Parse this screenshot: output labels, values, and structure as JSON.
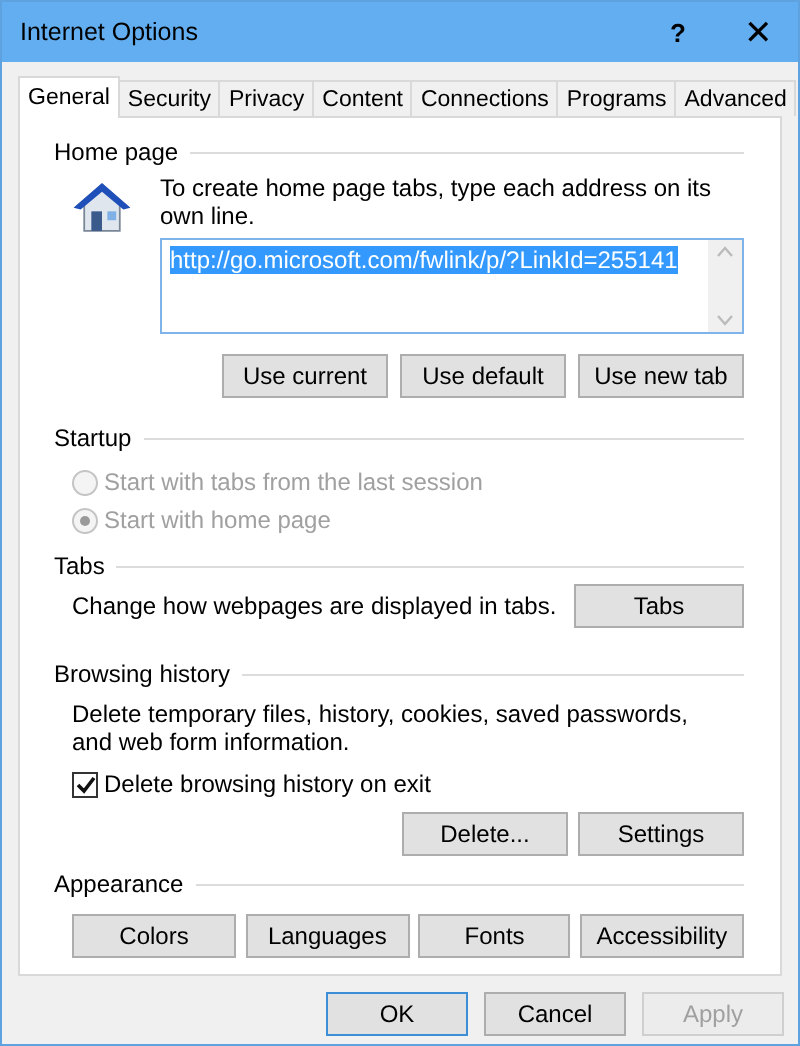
{
  "window": {
    "title": "Internet Options",
    "help": "?",
    "close": "✕"
  },
  "tabs": [
    {
      "label": "General",
      "selected": true
    },
    {
      "label": "Security",
      "selected": false
    },
    {
      "label": "Privacy",
      "selected": false
    },
    {
      "label": "Content",
      "selected": false
    },
    {
      "label": "Connections",
      "selected": false
    },
    {
      "label": "Programs",
      "selected": false
    },
    {
      "label": "Advanced",
      "selected": false
    }
  ],
  "home_page": {
    "heading": "Home page",
    "instruction": "To create home page tabs, type each address on its own line.",
    "value": "http://go.microsoft.com/fwlink/p/?LinkId=255141",
    "highlighted": true,
    "buttons": [
      "Use current",
      "Use default",
      "Use new tab"
    ]
  },
  "startup": {
    "heading": "Startup",
    "options": [
      {
        "label": "Start with tabs from the last session",
        "selected": false,
        "disabled": true
      },
      {
        "label": "Start with home page",
        "selected": true,
        "disabled": true
      }
    ]
  },
  "tabs_section": {
    "heading": "Tabs",
    "description": "Change how webpages are displayed in tabs.",
    "button": "Tabs"
  },
  "browsing_history": {
    "heading": "Browsing history",
    "description": "Delete temporary files, history, cookies, saved passwords, and web form information.",
    "checkbox": {
      "label": "Delete browsing history on exit",
      "checked": true
    },
    "buttons": [
      "Delete...",
      "Settings"
    ]
  },
  "appearance": {
    "heading": "Appearance",
    "buttons": [
      "Colors",
      "Languages",
      "Fonts",
      "Accessibility"
    ]
  },
  "dialog_buttons": [
    {
      "label": "OK",
      "default": true,
      "disabled": false
    },
    {
      "label": "Cancel",
      "default": false,
      "disabled": false
    },
    {
      "label": "Apply",
      "default": false,
      "disabled": true
    }
  ]
}
